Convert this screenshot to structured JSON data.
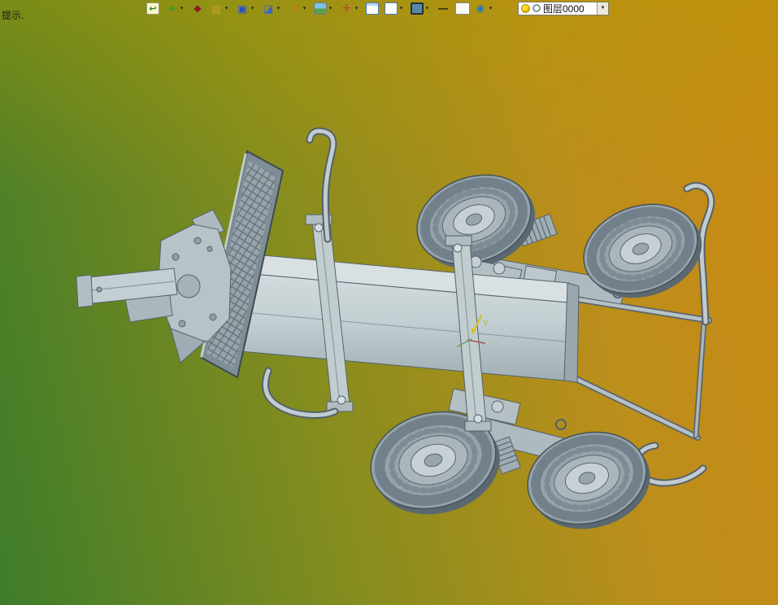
{
  "app": {
    "hint_text": "提示."
  },
  "toolbar": {
    "dropdown_glyph": "▾",
    "items": [
      {
        "name": "zoom-previous",
        "glyph": "↩",
        "dropdown": false
      },
      {
        "name": "render-quality",
        "glyph": "✦",
        "dropdown": true
      },
      {
        "name": "material-diamond",
        "glyph": "◆",
        "dropdown": false
      },
      {
        "name": "isometric-box",
        "glyph": "▧",
        "dropdown": true
      },
      {
        "name": "view-orientation",
        "glyph": "▣",
        "dropdown": true
      },
      {
        "name": "view-cube",
        "glyph": "◪",
        "dropdown": true
      },
      {
        "name": "section-wheel",
        "glyph": "☀",
        "dropdown": true
      },
      {
        "name": "scene-background",
        "glyph": "",
        "dropdown": true
      },
      {
        "name": "move-crosshair",
        "glyph": "✛",
        "dropdown": true
      },
      {
        "name": "viewport-window",
        "glyph": "",
        "dropdown": false
      },
      {
        "name": "new-viewport",
        "glyph": "",
        "dropdown": true
      },
      {
        "name": "display-style",
        "glyph": "",
        "dropdown": true
      },
      {
        "name": "line-width",
        "glyph": "—",
        "dropdown": false
      },
      {
        "name": "blank-sheet",
        "glyph": "",
        "dropdown": false
      },
      {
        "name": "visibility-lens",
        "glyph": "◉",
        "dropdown": true
      }
    ]
  },
  "layer_combo": {
    "value": "图层0000",
    "arrow_glyph": "▼"
  },
  "viewport": {
    "triad_y_label": "Y"
  },
  "colors": {
    "bg_green": "#3e7c2a",
    "bg_olive": "#868d1e",
    "bg_orange": "#cb8a14",
    "model_metal": "#b7c3c7",
    "model_edge": "#55626a",
    "tire_gray": "#95a3ab",
    "triad_yellow": "#d8c020"
  }
}
